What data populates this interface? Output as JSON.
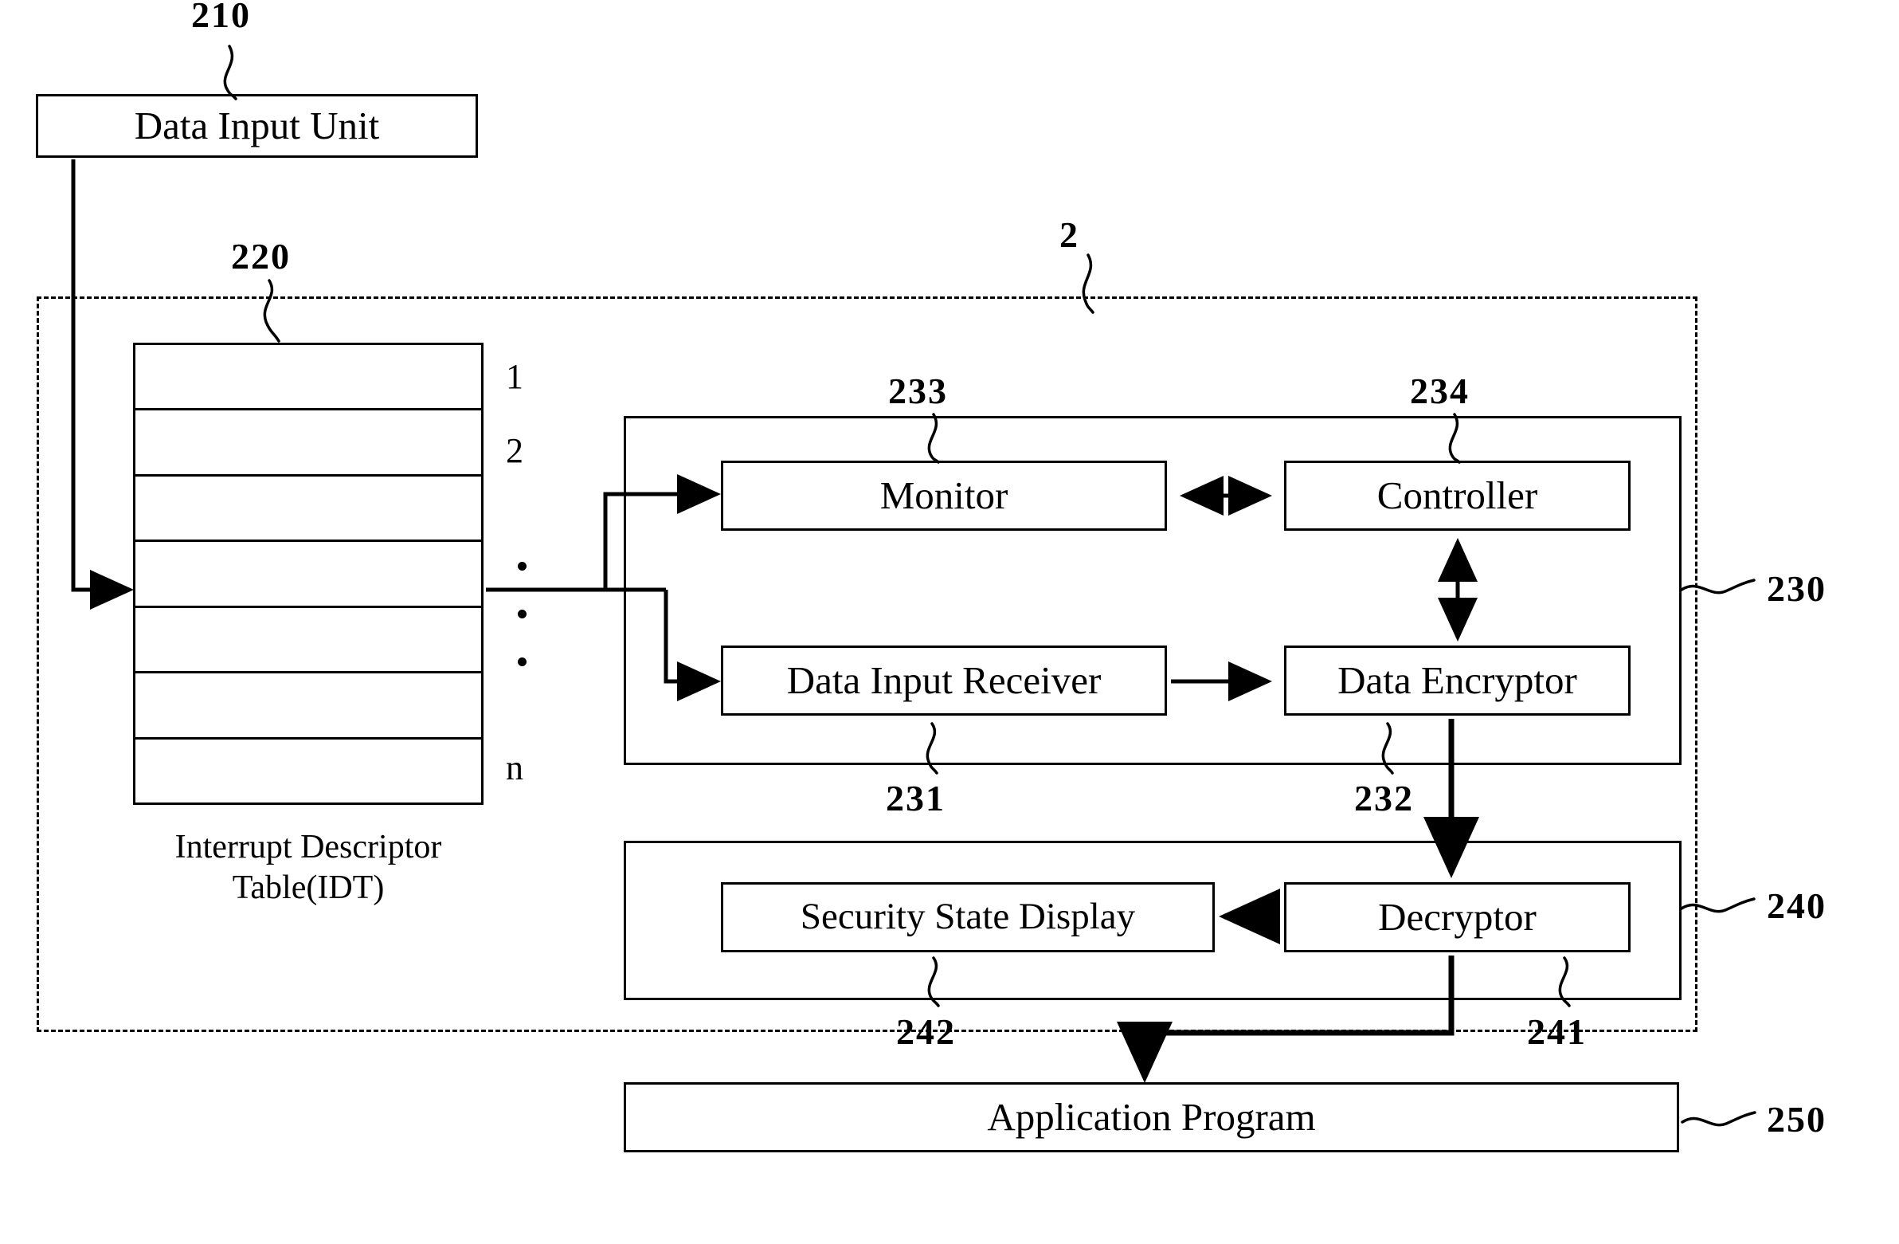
{
  "figure": {
    "type": "patent-block-diagram",
    "system_ref": "2"
  },
  "blocks": {
    "data_input_unit": {
      "label": "Data Input Unit",
      "ref": "210"
    },
    "idt": {
      "caption_line1": "Interrupt Descriptor",
      "caption_line2": "Table(IDT)",
      "ref": "220",
      "row_labels": [
        "1",
        "2",
        "n"
      ],
      "row_count": 7,
      "ellipsis_dots": 3
    },
    "secure_input_module": {
      "ref": "230"
    },
    "monitor": {
      "label": "Monitor",
      "ref": "233"
    },
    "controller": {
      "label": "Controller",
      "ref": "234"
    },
    "data_input_receiver": {
      "label": "Data Input Receiver",
      "ref": "231"
    },
    "data_encryptor": {
      "label": "Data Encryptor",
      "ref": "232"
    },
    "display_module": {
      "ref": "240"
    },
    "security_state_display": {
      "label": "Security State Display",
      "ref": "242"
    },
    "decryptor": {
      "label": "Decryptor",
      "ref": "241"
    },
    "application_program": {
      "label": "Application Program",
      "ref": "250"
    }
  },
  "colors": {
    "stroke": "#000000",
    "background": "#ffffff"
  }
}
